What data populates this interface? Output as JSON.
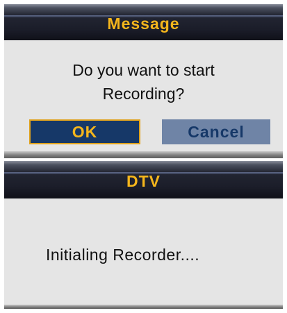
{
  "record_dialog": {
    "title": "Message",
    "message_line1": "Do you want to start",
    "message_line2": "Recording?",
    "ok_label": "OK",
    "cancel_label": "Cancel",
    "selected_button": "OK"
  },
  "status_dialog": {
    "title": "DTV",
    "status_text": "Initialing Recorder...."
  },
  "colors": {
    "title_text": "#f5b61c",
    "titlebar_dark": "#1b1d29",
    "dialog_bg": "#e5e5e5",
    "ok_button_bg": "#163868",
    "ok_button_border": "#e0a21c",
    "cancel_button_bg": "#6f84a6"
  }
}
